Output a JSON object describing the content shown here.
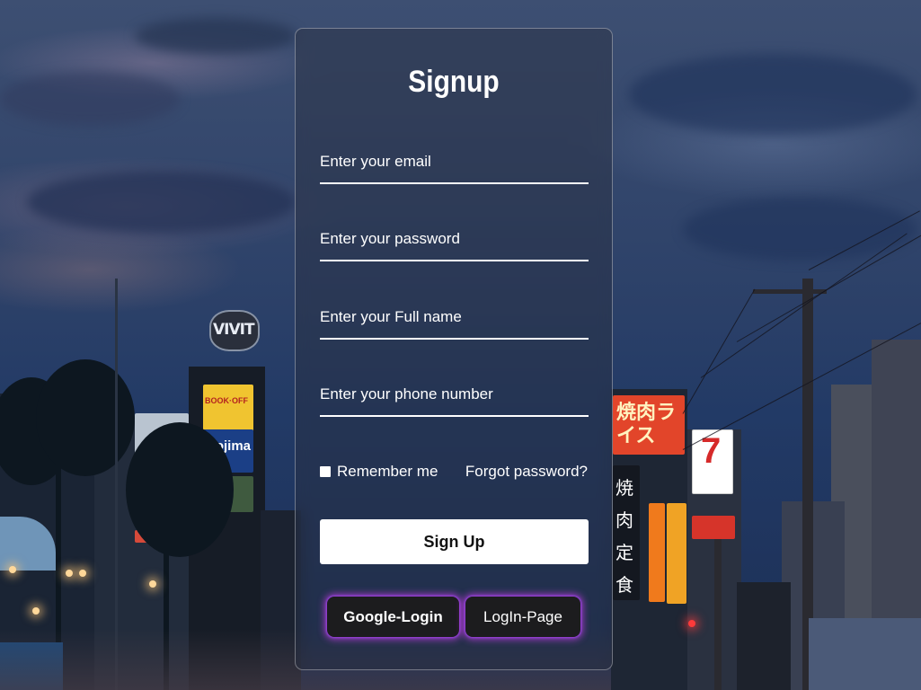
{
  "form": {
    "title": "Signup",
    "email_placeholder": "Enter your email",
    "password_placeholder": "Enter your password",
    "fullname_placeholder": "Enter your Full name",
    "phone_placeholder": "Enter your phone number",
    "remember_label": "Remember me",
    "forgot_label": "Forgot password?",
    "signup_label": "Sign Up",
    "google_label": "Google-Login",
    "login_page_label": "LogIn-Page"
  },
  "background": {
    "signs": [
      "VIVIT",
      "BOOK·OFF",
      "Nojima",
      "焼肉定食",
      "焼肉ライス",
      "7"
    ]
  },
  "colors": {
    "accent_glow": "#be3cdc",
    "button_dark": "#1c1c1e",
    "text": "#ffffff"
  }
}
